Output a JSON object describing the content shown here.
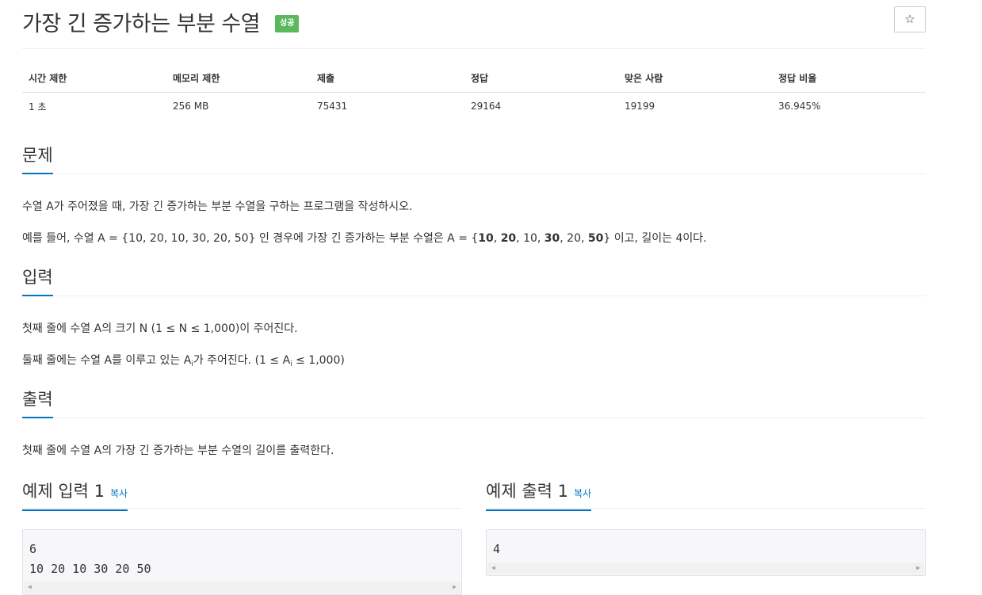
{
  "problem": {
    "title": "가장 긴 증가하는 부분 수열",
    "badge": "성공",
    "star_icon": "☆"
  },
  "info": {
    "headers": [
      "시간 제한",
      "메모리 제한",
      "제출",
      "정답",
      "맞은 사람",
      "정답 비율"
    ],
    "values": [
      "1 초",
      "256 MB",
      "75431",
      "29164",
      "19199",
      "36.945%"
    ]
  },
  "sections": {
    "problem_heading": "문제",
    "problem_line1": "수열 A가 주어졌을 때, 가장 긴 증가하는 부분 수열을 구하는 프로그램을 작성하시오.",
    "problem_line2_a": "예를 들어, 수열 A = {10, 20, 10, 30, 20, 50} 인 경우에 가장 긴 증가하는 부분 수열은 A = {",
    "problem_line2_b1": "10",
    "problem_line2_c1": ", ",
    "problem_line2_b2": "20",
    "problem_line2_c2": ", 10, ",
    "problem_line2_b3": "30",
    "problem_line2_c3": ", 20, ",
    "problem_line2_b4": "50",
    "problem_line2_d": "} 이고, 길이는 4이다.",
    "input_heading": "입력",
    "input_line1": "첫째 줄에 수열 A의 크기 N (1 ≤ N ≤ 1,000)이 주어진다.",
    "input_line2_a": "둘째 줄에는 수열 A를 이루고 있는 A",
    "input_line2_sub1": "i",
    "input_line2_b": "가 주어진다. (1 ≤ A",
    "input_line2_sub2": "i",
    "input_line2_c": " ≤ 1,000)",
    "output_heading": "출력",
    "output_line1": "첫째 줄에 수열 A의 가장 긴 증가하는 부분 수열의 길이를 출력한다."
  },
  "samples": {
    "input_title": "예제 입력 1",
    "output_title": "예제 출력 1",
    "copy_label": "복사",
    "input_line1": "6",
    "input_line2": "10 20 10 30 20 50",
    "output_line1": "4"
  }
}
